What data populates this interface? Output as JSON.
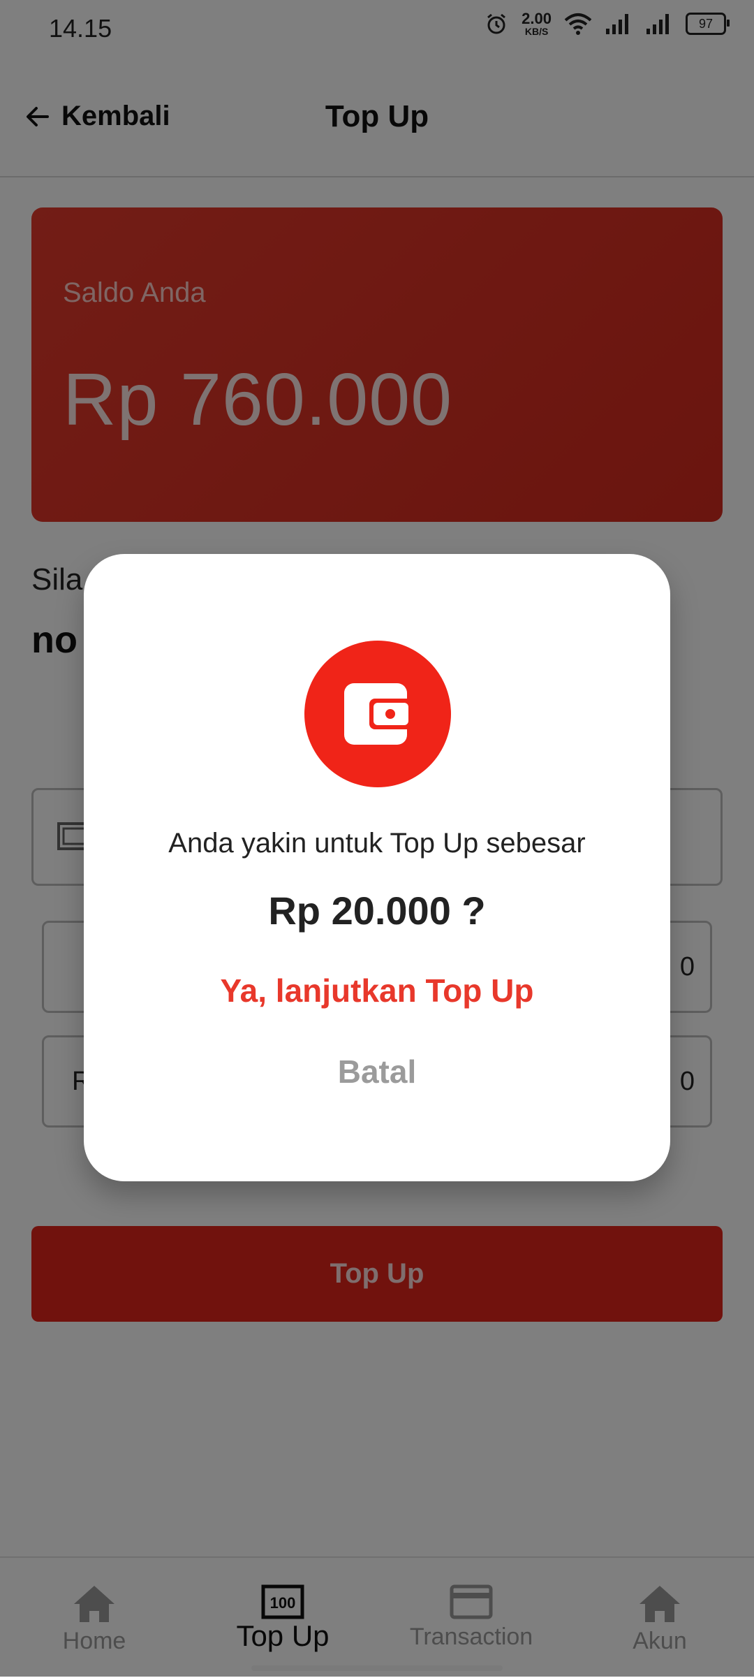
{
  "status_bar": {
    "time": "14.15",
    "net_speed_value": "2.00",
    "net_speed_unit": "KB/S",
    "battery": "97"
  },
  "app_bar": {
    "back_label": "Kembali",
    "title": "Top Up"
  },
  "balance": {
    "label": "Saldo Anda",
    "value": "Rp 760.000"
  },
  "form": {
    "hint_partial": "Sila",
    "hint_bold_partial": "no",
    "option_left_row2_partial": "R",
    "option_right_row2_partial": "0",
    "option_right_row1_partial": "0"
  },
  "topup_button": "Top Up",
  "dialog": {
    "message": "Anda yakin untuk Top Up sebesar",
    "amount": "Rp 20.000 ?",
    "confirm": "Ya, lanjutkan Top Up",
    "cancel": "Batal"
  },
  "bottom_nav": {
    "items": [
      {
        "label": "Home",
        "icon": "home-icon"
      },
      {
        "label": "Top Up",
        "icon": "money-icon"
      },
      {
        "label": "Transaction",
        "icon": "card-icon"
      },
      {
        "label": "Akun",
        "icon": "home-icon"
      }
    ],
    "active_index": 1
  },
  "colors": {
    "accent": "#e8382b",
    "card": "#e53a2c"
  }
}
